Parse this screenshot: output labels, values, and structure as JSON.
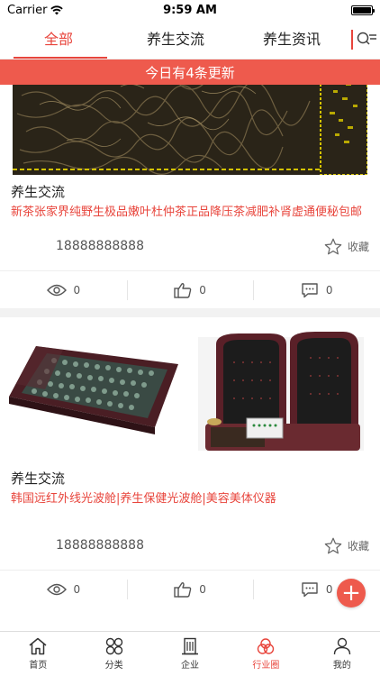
{
  "status": {
    "carrier": "Carrier",
    "time": "9:59 AM",
    "battery_level": 1.0
  },
  "tabs": [
    {
      "label": "全部",
      "active": true
    },
    {
      "label": "养生交流",
      "active": false
    },
    {
      "label": "养生资讯",
      "active": false
    }
  ],
  "banner": {
    "text": "今日有4条更新"
  },
  "posts": [
    {
      "category": "养生交流",
      "description": "新茶张家界纯野生极品嫩叶杜仲茶正品降压茶减肥补肾虚通便秘包邮",
      "phone": "18888888888",
      "favorite_label": "收藏",
      "views": "0",
      "likes": "0",
      "comments": "0"
    },
    {
      "category": "养生交流",
      "description": "韩国远红外线光波舱|养生保健光波舱|美容美体仪器",
      "phone": "18888888888",
      "favorite_label": "收藏",
      "views": "0",
      "likes": "0",
      "comments": "0"
    }
  ],
  "fab": {
    "symbol": "+"
  },
  "bottom_nav": [
    {
      "label": "首页",
      "icon": "home-icon",
      "active": false
    },
    {
      "label": "分类",
      "icon": "category-icon",
      "active": false
    },
    {
      "label": "企业",
      "icon": "building-icon",
      "active": false
    },
    {
      "label": "行业圈",
      "icon": "circles-icon",
      "active": true
    },
    {
      "label": "我的",
      "icon": "user-icon",
      "active": false
    }
  ],
  "colors": {
    "accent": "#e8453c",
    "banner": "#ee5a4d"
  }
}
